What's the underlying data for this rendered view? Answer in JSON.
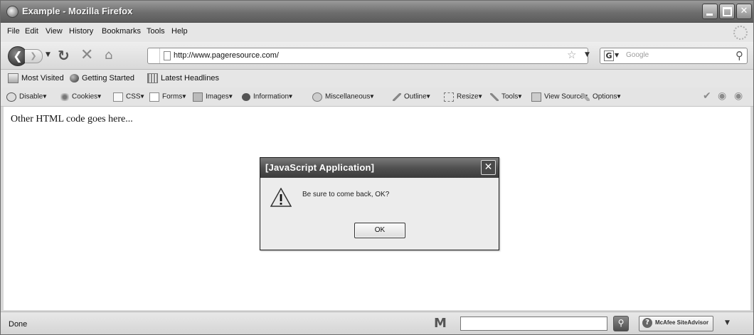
{
  "window": {
    "title": "Example - Mozilla Firefox"
  },
  "menu": [
    "File",
    "Edit",
    "View",
    "History",
    "Bookmarks",
    "Tools",
    "Help"
  ],
  "nav": {
    "url": "http://www.pageresource.com/",
    "search_placeholder": "Google",
    "search_engine_glyph": "G"
  },
  "bookmarks": [
    "Most Visited",
    "Getting Started",
    "Latest Headlines"
  ],
  "devtoolbar": [
    "Disable▾",
    "Cookies▾",
    "CSS▾",
    "Forms▾",
    "Images▾",
    "Information▾",
    "Miscellaneous▾",
    "Outline▾",
    "Resize▾",
    "Tools▾",
    "View Source▾",
    "Options▾"
  ],
  "content": {
    "text": "Other HTML code goes here..."
  },
  "dialog": {
    "title": "[JavaScript Application]",
    "message": "Be sure to come back, OK?",
    "ok_label": "OK"
  },
  "status": {
    "text": "Done",
    "siteadvisor_label": "McAfee SiteAdvisor"
  },
  "colors": {
    "chrome": "#d8d8d8",
    "titlebar": "#6e6e6e",
    "dialog_title": "#4a4a4a"
  }
}
